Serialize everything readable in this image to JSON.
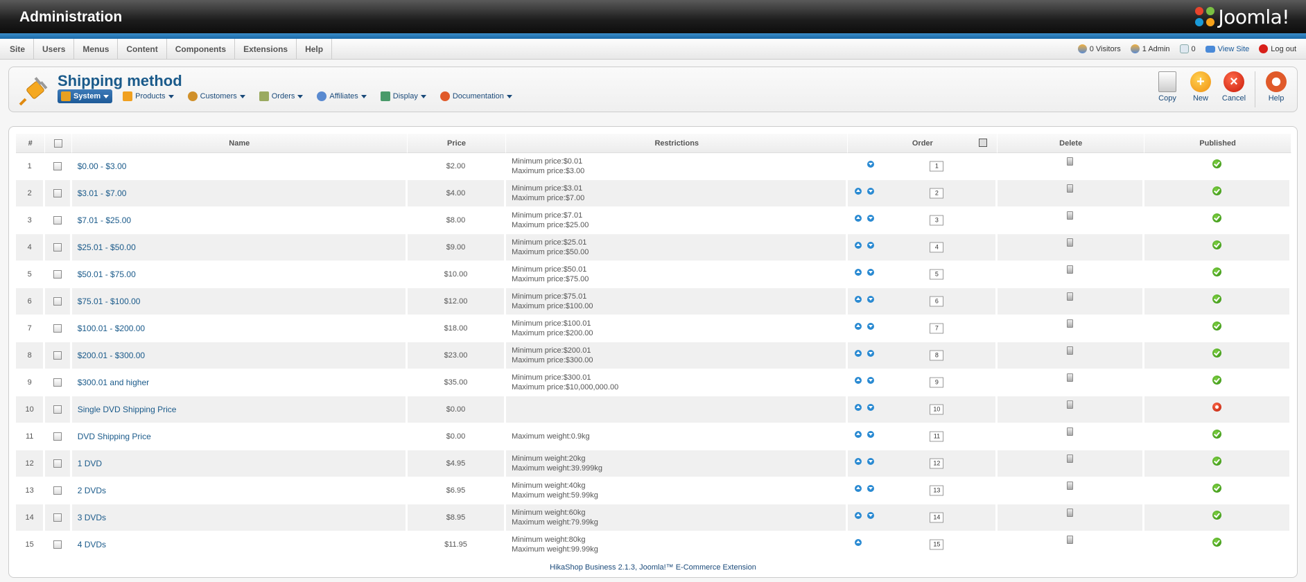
{
  "header": {
    "title": "Administration",
    "brand": "Joomla!"
  },
  "menubar": {
    "items": [
      "Site",
      "Users",
      "Menus",
      "Content",
      "Components",
      "Extensions",
      "Help"
    ],
    "status": {
      "visitors": "0 Visitors",
      "admin": "1 Admin",
      "messages": "0",
      "view_site": "View Site",
      "logout": "Log out"
    }
  },
  "toolbar": {
    "title": "Shipping method",
    "submenu": [
      {
        "label": "System",
        "active": true,
        "icon": "wrench-icon",
        "color": "#e8a020"
      },
      {
        "label": "Products",
        "active": false,
        "icon": "products-icon",
        "color": "#f0a020"
      },
      {
        "label": "Customers",
        "active": false,
        "icon": "customers-icon",
        "color": "#d0902a"
      },
      {
        "label": "Orders",
        "active": false,
        "icon": "orders-icon",
        "color": "#9aaa60"
      },
      {
        "label": "Affiliates",
        "active": false,
        "icon": "affiliates-icon",
        "color": "#5a8ad0"
      },
      {
        "label": "Display",
        "active": false,
        "icon": "display-icon",
        "color": "#4a9a6a"
      },
      {
        "label": "Documentation",
        "active": false,
        "icon": "lifebuoy-icon",
        "color": "#e05a2a"
      }
    ],
    "buttons": {
      "copy": "Copy",
      "new": "New",
      "cancel": "Cancel",
      "help": "Help"
    }
  },
  "table": {
    "headers": {
      "num": "#",
      "name": "Name",
      "price": "Price",
      "restrictions": "Restrictions",
      "order": "Order",
      "delete": "Delete",
      "published": "Published"
    },
    "rows": [
      {
        "num": "1",
        "name": "$0.00 - $3.00",
        "price": "$2.00",
        "r1": "Minimum price:$0.01",
        "r2": "Maximum price:$3.00",
        "order": "1",
        "up": false,
        "down": true,
        "published": true
      },
      {
        "num": "2",
        "name": "$3.01 - $7.00",
        "price": "$4.00",
        "r1": "Minimum price:$3.01",
        "r2": "Maximum price:$7.00",
        "order": "2",
        "up": true,
        "down": true,
        "published": true
      },
      {
        "num": "3",
        "name": "$7.01 - $25.00",
        "price": "$8.00",
        "r1": "Minimum price:$7.01",
        "r2": "Maximum price:$25.00",
        "order": "3",
        "up": true,
        "down": true,
        "published": true
      },
      {
        "num": "4",
        "name": "$25.01 - $50.00",
        "price": "$9.00",
        "r1": "Minimum price:$25.01",
        "r2": "Maximum price:$50.00",
        "order": "4",
        "up": true,
        "down": true,
        "published": true
      },
      {
        "num": "5",
        "name": "$50.01 - $75.00",
        "price": "$10.00",
        "r1": "Minimum price:$50.01",
        "r2": "Maximum price:$75.00",
        "order": "5",
        "up": true,
        "down": true,
        "published": true
      },
      {
        "num": "6",
        "name": "$75.01 - $100.00",
        "price": "$12.00",
        "r1": "Minimum price:$75.01",
        "r2": "Maximum price:$100.00",
        "order": "6",
        "up": true,
        "down": true,
        "published": true
      },
      {
        "num": "7",
        "name": "$100.01 - $200.00",
        "price": "$18.00",
        "r1": "Minimum price:$100.01",
        "r2": "Maximum price:$200.00",
        "order": "7",
        "up": true,
        "down": true,
        "published": true
      },
      {
        "num": "8",
        "name": "$200.01 - $300.00",
        "price": "$23.00",
        "r1": "Minimum price:$200.01",
        "r2": "Maximum price:$300.00",
        "order": "8",
        "up": true,
        "down": true,
        "published": true
      },
      {
        "num": "9",
        "name": "$300.01 and higher",
        "price": "$35.00",
        "r1": "Minimum price:$300.01",
        "r2": "Maximum price:$10,000,000.00",
        "order": "9",
        "up": true,
        "down": true,
        "published": true
      },
      {
        "num": "10",
        "name": "Single DVD Shipping Price",
        "price": "$0.00",
        "r1": "",
        "r2": "",
        "order": "10",
        "up": true,
        "down": true,
        "published": false
      },
      {
        "num": "11",
        "name": "DVD Shipping Price",
        "price": "$0.00",
        "r1": "",
        "r2": "Maximum weight:0.9kg",
        "order": "11",
        "up": true,
        "down": true,
        "published": true
      },
      {
        "num": "12",
        "name": "1 DVD",
        "price": "$4.95",
        "r1": "Minimum weight:20kg",
        "r2": "Maximum weight:39.999kg",
        "order": "12",
        "up": true,
        "down": true,
        "published": true
      },
      {
        "num": "13",
        "name": "2 DVDs",
        "price": "$6.95",
        "r1": "Minimum weight:40kg",
        "r2": "Maximum weight:59.99kg",
        "order": "13",
        "up": true,
        "down": true,
        "published": true
      },
      {
        "num": "14",
        "name": "3 DVDs",
        "price": "$8.95",
        "r1": "Minimum weight:60kg",
        "r2": "Maximum weight:79.99kg",
        "order": "14",
        "up": true,
        "down": true,
        "published": true
      },
      {
        "num": "15",
        "name": "4 DVDs",
        "price": "$11.95",
        "r1": "Minimum weight:80kg",
        "r2": "Maximum weight:99.99kg",
        "order": "15",
        "up": true,
        "down": false,
        "published": true
      }
    ]
  },
  "footer": "HikaShop Business 2.1.3, Joomla!™ E-Commerce Extension",
  "colors": {
    "accent": "#1a5a8a",
    "header_stripe": "#2a7cbc",
    "published": "#3a9a1a",
    "unpublished": "#c82a10"
  }
}
